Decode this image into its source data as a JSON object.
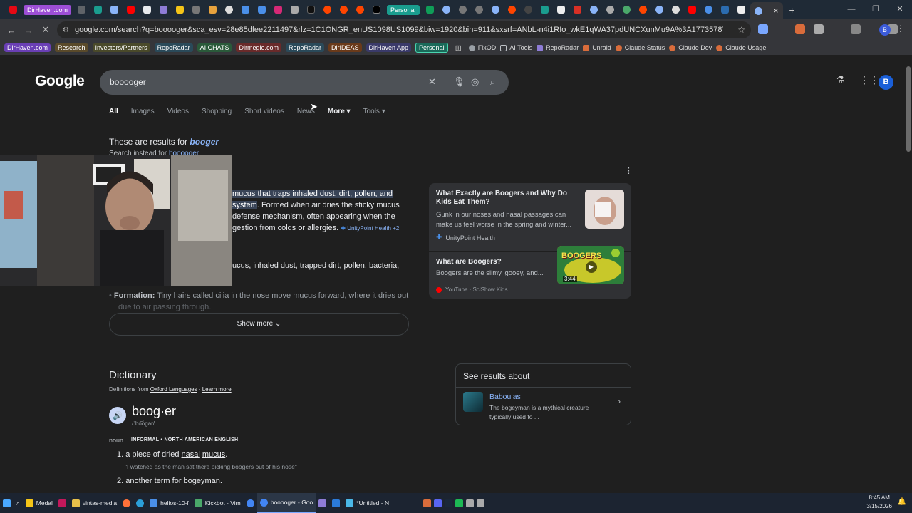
{
  "browser": {
    "tab_pills": [
      {
        "label": "DirHaven.com",
        "color": "#9c4fd6"
      },
      {
        "label": "Personal",
        "color": "#1a9d8f"
      }
    ],
    "active_tab_close": "×",
    "new_tab": "+",
    "url": "google.com/search?q=booooger&sca_esv=28e85dfee2211497&rlz=1C1ONGR_enUS1098US1099&biw=1920&bih=911&sxsrf=ANbL-n4i1RIo_wkE1qWA37pdUNCXunMu9A%3A1773578702395&ei=zqm2afHrF_ey5NoP6vzL4...",
    "profile_initial": "B"
  },
  "bookmarks": {
    "pills": [
      {
        "label": "DirHaven.com",
        "color": "#6a3fb5"
      },
      {
        "label": "Research",
        "color": "#5a4a2a"
      },
      {
        "label": "Investors/Partners",
        "color": "#4a4a2a"
      },
      {
        "label": "RepoRadar",
        "color": "#2a4a5a"
      },
      {
        "label": "AI CHATS",
        "color": "#2a5a3a"
      },
      {
        "label": "Dirmegle.com",
        "color": "#6a2a2a"
      },
      {
        "label": "RepoRadar",
        "color": "#2a4a5a"
      },
      {
        "label": "DirIDEAS",
        "color": "#6a3a1a"
      },
      {
        "label": "DirHaven App",
        "color": "#3a3a6a"
      },
      {
        "label": "Personal",
        "color": "#1a6a5a"
      }
    ],
    "links": [
      {
        "label": "FixOD",
        "color": "#9aa0a6"
      },
      {
        "label": "AI Tools",
        "color": "#bdc1c6"
      },
      {
        "label": "RepoRadar",
        "color": "#8e7cd6"
      },
      {
        "label": "Unraid",
        "color": "#d96c3b"
      },
      {
        "label": "Claude Status",
        "color": "#d96c3b"
      },
      {
        "label": "Claude Dev",
        "color": "#d96c3b"
      },
      {
        "label": "Claude Usage",
        "color": "#d96c3b"
      }
    ]
  },
  "google": {
    "logo": "Google",
    "query": "booooger",
    "tabs": [
      "All",
      "Images",
      "Videos",
      "Shopping",
      "Short videos",
      "News",
      "More",
      "Tools"
    ],
    "results_for_prefix": "These are results for ",
    "results_for_term": "booger",
    "search_instead_prefix": "Search instead for ",
    "search_instead_term": "booooger"
  },
  "overview": {
    "line1_hl": "mucus that traps inhaled dust, dirt, pollen, and",
    "line2_hl": "system",
    "line2_rest": ". Formed when air dries the sticky mucus",
    "line3": "defense mechanism, often appearing when the",
    "line4": "gestion from colds or allergies.",
    "source": "UnityPoint Health +2",
    "composition": "ucus, inhaled dust, trapped dirt, pollen, bacteria,",
    "formation_label": "Formation:",
    "formation_text": " Tiny hairs called cilia in the nose move mucus forward, where it dries out",
    "formation_text2": "due to air passing through.",
    "show_more": "Show more"
  },
  "videos": [
    {
      "title": "What Exactly are Boogers and Why Do Kids Eat Them?",
      "desc": "Gunk in our noses and nasal passages can make us feel worse in the spring and winter...",
      "source": "UnityPoint Health"
    },
    {
      "title": "What are Boogers?",
      "desc": "Boogers are the slimy, gooey, and...",
      "source": "YouTube · SciShow Kids",
      "duration": "3:44",
      "thumb_text": "BOOGERS"
    }
  ],
  "dictionary": {
    "title": "Dictionary",
    "from_prefix": "Definitions from ",
    "from_source": "Oxford Languages",
    "learn_more": "Learn more",
    "headword": "boog·er",
    "pronunciation": "/ˈbo͝ogər/",
    "pos": "noun",
    "tag": "INFORMAL • NORTH AMERICAN ENGLISH",
    "def1_prefix": "1. a piece of dried ",
    "def1_w1": "nasal",
    "def1_w2": "mucus",
    "def1_suffix": ".",
    "example1": "\"I watched as the man sat there picking boogers out of his nose\"",
    "def2_prefix": "2. another term for ",
    "def2_link": "bogeyman",
    "def2_suffix": "."
  },
  "see_results": {
    "heading": "See results about",
    "entity_name": "Baboulas",
    "entity_desc": "The bogeyman is a mythical creature typically used to ..."
  },
  "taskbar": {
    "items": [
      {
        "label": "Medal",
        "color": "#f5c518"
      },
      {
        "label": "vintas-media",
        "color": "#e8c04a"
      },
      {
        "label": "helios-10-f",
        "color": "#4a8fe8"
      },
      {
        "label": "Kickbot - Vim",
        "color": "#4aa86a"
      },
      {
        "label": "booooger - Goo",
        "color": "#4a8fe8"
      },
      {
        "label": "*Untitled - N",
        "color": "#4ab8e8"
      }
    ],
    "time": "8:45 AM",
    "date": "3/15/2026"
  }
}
